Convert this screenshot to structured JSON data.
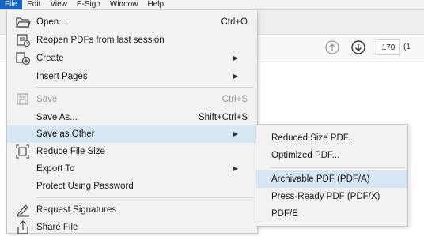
{
  "menubar": {
    "items": [
      "File",
      "Edit",
      "View",
      "E-Sign",
      "Window",
      "Help"
    ]
  },
  "toolbar": {
    "page_number": "170",
    "page_total": "(1"
  },
  "file_menu": {
    "open": {
      "label": "Open...",
      "shortcut": "Ctrl+O"
    },
    "reopen": {
      "label": "Reopen PDFs from last session"
    },
    "create": {
      "label": "Create"
    },
    "insert_pages": {
      "label": "Insert Pages"
    },
    "save": {
      "label": "Save",
      "shortcut": "Ctrl+S"
    },
    "save_as": {
      "label": "Save As...",
      "shortcut": "Shift+Ctrl+S"
    },
    "save_as_other": {
      "label": "Save as Other"
    },
    "reduce_file_size": {
      "label": "Reduce File Size"
    },
    "export_to": {
      "label": "Export To"
    },
    "protect": {
      "label": "Protect Using Password"
    },
    "request_signatures": {
      "label": "Request Signatures"
    },
    "share_file": {
      "label": "Share File"
    }
  },
  "save_as_other_submenu": {
    "reduced_size": "Reduced Size PDF...",
    "optimized": "Optimized PDF...",
    "archivable": "Archivable PDF (PDF/A)",
    "press_ready": "Press-Ready PDF (PDF/X)",
    "pdf_e": "PDF/E"
  },
  "colors": {
    "menu_bg": "#f2f2f2",
    "highlight": "#d7e6f5",
    "active_menu": "#1565c0"
  }
}
